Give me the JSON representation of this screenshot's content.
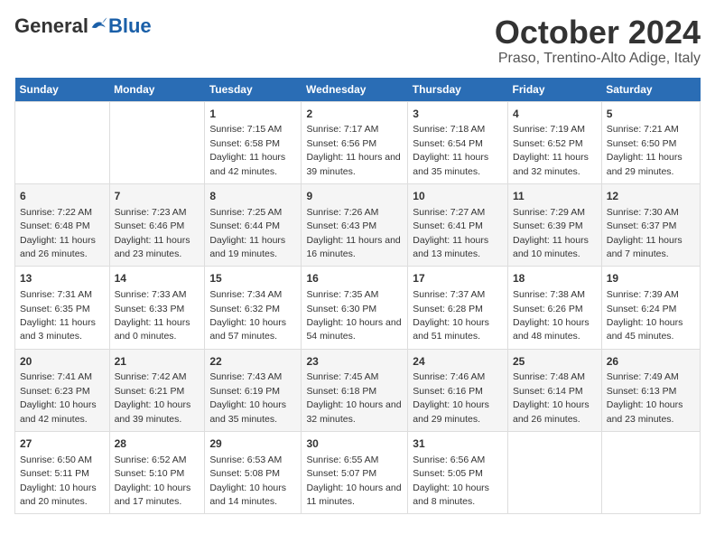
{
  "header": {
    "logo_general": "General",
    "logo_blue": "Blue",
    "title": "October 2024",
    "subtitle": "Praso, Trentino-Alto Adige, Italy"
  },
  "columns": [
    "Sunday",
    "Monday",
    "Tuesday",
    "Wednesday",
    "Thursday",
    "Friday",
    "Saturday"
  ],
  "weeks": [
    [
      {
        "day": "",
        "info": ""
      },
      {
        "day": "",
        "info": ""
      },
      {
        "day": "1",
        "info": "Sunrise: 7:15 AM\nSunset: 6:58 PM\nDaylight: 11 hours and 42 minutes."
      },
      {
        "day": "2",
        "info": "Sunrise: 7:17 AM\nSunset: 6:56 PM\nDaylight: 11 hours and 39 minutes."
      },
      {
        "day": "3",
        "info": "Sunrise: 7:18 AM\nSunset: 6:54 PM\nDaylight: 11 hours and 35 minutes."
      },
      {
        "day": "4",
        "info": "Sunrise: 7:19 AM\nSunset: 6:52 PM\nDaylight: 11 hours and 32 minutes."
      },
      {
        "day": "5",
        "info": "Sunrise: 7:21 AM\nSunset: 6:50 PM\nDaylight: 11 hours and 29 minutes."
      }
    ],
    [
      {
        "day": "6",
        "info": "Sunrise: 7:22 AM\nSunset: 6:48 PM\nDaylight: 11 hours and 26 minutes."
      },
      {
        "day": "7",
        "info": "Sunrise: 7:23 AM\nSunset: 6:46 PM\nDaylight: 11 hours and 23 minutes."
      },
      {
        "day": "8",
        "info": "Sunrise: 7:25 AM\nSunset: 6:44 PM\nDaylight: 11 hours and 19 minutes."
      },
      {
        "day": "9",
        "info": "Sunrise: 7:26 AM\nSunset: 6:43 PM\nDaylight: 11 hours and 16 minutes."
      },
      {
        "day": "10",
        "info": "Sunrise: 7:27 AM\nSunset: 6:41 PM\nDaylight: 11 hours and 13 minutes."
      },
      {
        "day": "11",
        "info": "Sunrise: 7:29 AM\nSunset: 6:39 PM\nDaylight: 11 hours and 10 minutes."
      },
      {
        "day": "12",
        "info": "Sunrise: 7:30 AM\nSunset: 6:37 PM\nDaylight: 11 hours and 7 minutes."
      }
    ],
    [
      {
        "day": "13",
        "info": "Sunrise: 7:31 AM\nSunset: 6:35 PM\nDaylight: 11 hours and 3 minutes."
      },
      {
        "day": "14",
        "info": "Sunrise: 7:33 AM\nSunset: 6:33 PM\nDaylight: 11 hours and 0 minutes."
      },
      {
        "day": "15",
        "info": "Sunrise: 7:34 AM\nSunset: 6:32 PM\nDaylight: 10 hours and 57 minutes."
      },
      {
        "day": "16",
        "info": "Sunrise: 7:35 AM\nSunset: 6:30 PM\nDaylight: 10 hours and 54 minutes."
      },
      {
        "day": "17",
        "info": "Sunrise: 7:37 AM\nSunset: 6:28 PM\nDaylight: 10 hours and 51 minutes."
      },
      {
        "day": "18",
        "info": "Sunrise: 7:38 AM\nSunset: 6:26 PM\nDaylight: 10 hours and 48 minutes."
      },
      {
        "day": "19",
        "info": "Sunrise: 7:39 AM\nSunset: 6:24 PM\nDaylight: 10 hours and 45 minutes."
      }
    ],
    [
      {
        "day": "20",
        "info": "Sunrise: 7:41 AM\nSunset: 6:23 PM\nDaylight: 10 hours and 42 minutes."
      },
      {
        "day": "21",
        "info": "Sunrise: 7:42 AM\nSunset: 6:21 PM\nDaylight: 10 hours and 39 minutes."
      },
      {
        "day": "22",
        "info": "Sunrise: 7:43 AM\nSunset: 6:19 PM\nDaylight: 10 hours and 35 minutes."
      },
      {
        "day": "23",
        "info": "Sunrise: 7:45 AM\nSunset: 6:18 PM\nDaylight: 10 hours and 32 minutes."
      },
      {
        "day": "24",
        "info": "Sunrise: 7:46 AM\nSunset: 6:16 PM\nDaylight: 10 hours and 29 minutes."
      },
      {
        "day": "25",
        "info": "Sunrise: 7:48 AM\nSunset: 6:14 PM\nDaylight: 10 hours and 26 minutes."
      },
      {
        "day": "26",
        "info": "Sunrise: 7:49 AM\nSunset: 6:13 PM\nDaylight: 10 hours and 23 minutes."
      }
    ],
    [
      {
        "day": "27",
        "info": "Sunrise: 6:50 AM\nSunset: 5:11 PM\nDaylight: 10 hours and 20 minutes."
      },
      {
        "day": "28",
        "info": "Sunrise: 6:52 AM\nSunset: 5:10 PM\nDaylight: 10 hours and 17 minutes."
      },
      {
        "day": "29",
        "info": "Sunrise: 6:53 AM\nSunset: 5:08 PM\nDaylight: 10 hours and 14 minutes."
      },
      {
        "day": "30",
        "info": "Sunrise: 6:55 AM\nSunset: 5:07 PM\nDaylight: 10 hours and 11 minutes."
      },
      {
        "day": "31",
        "info": "Sunrise: 6:56 AM\nSunset: 5:05 PM\nDaylight: 10 hours and 8 minutes."
      },
      {
        "day": "",
        "info": ""
      },
      {
        "day": "",
        "info": ""
      }
    ]
  ]
}
